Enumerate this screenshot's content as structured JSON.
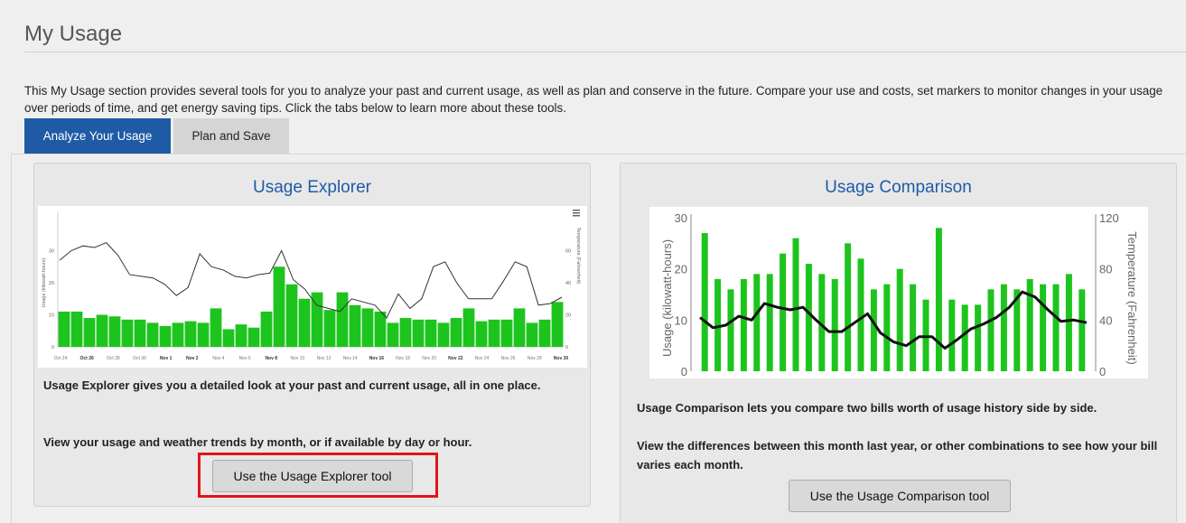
{
  "page": {
    "title": "My Usage",
    "intro": "This My Usage section provides several tools for you to analyze your past and current usage, as well as plan and conserve in the future. Compare your use and costs, set markers to monitor changes in your usage over periods of time, and get energy saving tips. Click the tabs below to learn more about these tools."
  },
  "tabs": [
    {
      "label": "Analyze Your Usage",
      "active": true
    },
    {
      "label": "Plan and Save",
      "active": false
    }
  ],
  "cards": {
    "explorer": {
      "title": "Usage Explorer",
      "text1": "Usage Explorer gives you a detailed look at your past and current usage, all in one place.",
      "text2": "View your usage and weather trends by month, or if available by day or hour.",
      "button": "Use the Usage Explorer tool"
    },
    "comparison": {
      "title": "Usage Comparison",
      "text1": "Usage Comparison lets you compare two bills worth of usage history side by side.",
      "text2": "View the differences between this month last year, or other combinations to see how your bill varies each month.",
      "button": "Use the Usage Comparison tool"
    }
  },
  "colors": {
    "accent": "#1f5aa6",
    "bar": "#1dc41d",
    "highlight": "#e0151b"
  },
  "icons": {
    "chart_menu": "hamburger-menu-icon"
  },
  "chart_data": [
    {
      "type": "bar",
      "ylabel": "Usage (kilowatt-hours)",
      "y2label": "Temperature (Fahrenheit)",
      "ylim": [
        0,
        40
      ],
      "y2lim": [
        0,
        80
      ],
      "y_ticks": [
        "0",
        "10",
        "20",
        "30"
      ],
      "y2_ticks": [
        "0",
        "20",
        "40",
        "60"
      ],
      "x_ticks": [
        {
          "label": "Oct 24",
          "bold": false
        },
        {
          "label": "Oct 26",
          "bold": true
        },
        {
          "label": "Oct 28",
          "bold": false
        },
        {
          "label": "Oct 30",
          "bold": false
        },
        {
          "label": "Nov 1",
          "bold": true
        },
        {
          "label": "Nov 2",
          "bold": true
        },
        {
          "label": "Nov 4",
          "bold": false
        },
        {
          "label": "Nov 6",
          "bold": false
        },
        {
          "label": "Nov 8",
          "bold": true
        },
        {
          "label": "Nov 10",
          "bold": false
        },
        {
          "label": "Nov 12",
          "bold": false
        },
        {
          "label": "Nov 14",
          "bold": false
        },
        {
          "label": "Nov 16",
          "bold": true
        },
        {
          "label": "Nov 18",
          "bold": false
        },
        {
          "label": "Nov 20",
          "bold": false
        },
        {
          "label": "Nov 22",
          "bold": true
        },
        {
          "label": "Nov 24",
          "bold": false
        },
        {
          "label": "Nov 26",
          "bold": false
        },
        {
          "label": "Nov 28",
          "bold": false
        },
        {
          "label": "Nov 30",
          "bold": true
        }
      ],
      "series": [
        {
          "values": [
            11,
            11,
            9,
            10,
            9.5,
            8.5,
            8.5,
            7.5,
            6.5,
            7.5,
            8,
            7.5,
            12,
            5.5,
            7,
            6,
            11,
            25,
            19.5,
            15,
            17,
            11.5,
            17,
            13,
            12,
            11,
            7.5,
            9,
            8.5,
            8.5,
            7.5,
            9,
            12,
            8,
            8.5,
            8.5,
            12,
            7.5,
            8.5,
            14
          ]
        },
        {
          "values": [
            54,
            60,
            63,
            62,
            65,
            57,
            45,
            44,
            43,
            39,
            32,
            37,
            58,
            50,
            48,
            44,
            43,
            45,
            46,
            60,
            42,
            36,
            26,
            24,
            22,
            30,
            28,
            26,
            18,
            33,
            24,
            30,
            50,
            53,
            40,
            30,
            30,
            30,
            41,
            53,
            50,
            26,
            27,
            31
          ]
        }
      ]
    },
    {
      "type": "bar",
      "ylabel": "Usage (kilowatt-hours)",
      "y2label": "Temperature (Fahrenheit)",
      "ylim": [
        0,
        30
      ],
      "y2lim": [
        0,
        120
      ],
      "y_ticks": [
        "0",
        "10",
        "20",
        "30"
      ],
      "y2_ticks": [
        "0",
        "40",
        "80",
        "120"
      ],
      "series": [
        {
          "values": [
            27,
            18,
            16,
            18,
            19,
            19,
            23,
            26,
            21,
            19,
            18,
            25,
            22,
            16,
            17,
            20,
            17,
            14,
            28,
            14,
            13,
            13,
            16,
            17,
            16,
            18,
            17,
            17,
            19,
            16
          ]
        },
        {
          "values": [
            42,
            34,
            36,
            43,
            40,
            53,
            50,
            48,
            50,
            40,
            31,
            31,
            38,
            45,
            30,
            23,
            20,
            27,
            27,
            18,
            25,
            33,
            37,
            42,
            50,
            62,
            58,
            48,
            39,
            40,
            38
          ]
        }
      ]
    }
  ]
}
